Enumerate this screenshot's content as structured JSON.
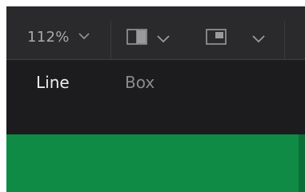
{
  "toolbar": {
    "zoom_label": "112%",
    "zoom_dropdown_icon": "chevron-down-icon",
    "split_view_icon": "split-view-icon",
    "split_dropdown_icon": "chevron-down-icon",
    "pip_view_icon": "picture-in-picture-icon",
    "pip_dropdown_icon": "chevron-down-icon"
  },
  "tabs": [
    {
      "label": "Line",
      "active": true
    },
    {
      "label": "Box",
      "active": false
    }
  ],
  "colors": {
    "toolbar_bg": "#2a2a2c",
    "accent_line": "#6e2a2a",
    "preview_green": "#0f8b45"
  }
}
